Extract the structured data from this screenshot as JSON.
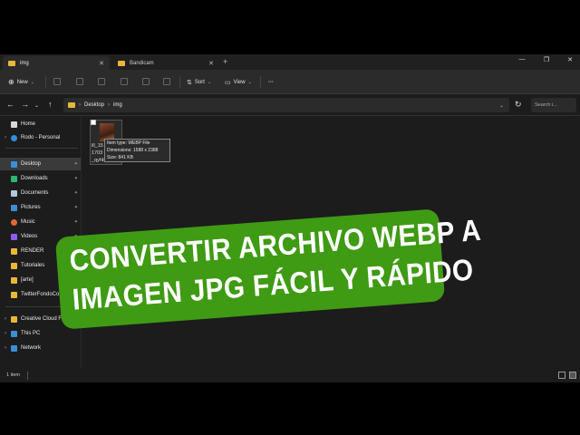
{
  "tabs": [
    {
      "label": "img",
      "active": true
    },
    {
      "label": "Bandicam",
      "active": false
    }
  ],
  "toolbar": {
    "new_label": "New",
    "sort_label": "Sort",
    "view_label": "View",
    "more_label": "···"
  },
  "address": {
    "path": [
      "Desktop",
      "img"
    ],
    "search_placeholder": "Search i..."
  },
  "sidebar": {
    "items": [
      {
        "label": "Home",
        "icon": "home-icon"
      },
      {
        "label": "Rodo - Personal",
        "icon": "onedrive-icon"
      },
      {
        "label": "Desktop",
        "icon": "desktop-icon",
        "pinned": true,
        "selected": true
      },
      {
        "label": "Downloads",
        "icon": "download-icon",
        "pinned": true
      },
      {
        "label": "Documents",
        "icon": "document-icon",
        "pinned": true
      },
      {
        "label": "Pictures",
        "icon": "pictures-icon",
        "pinned": true
      },
      {
        "label": "Music",
        "icon": "music-icon",
        "pinned": true
      },
      {
        "label": "Videos",
        "icon": "videos-icon",
        "pinned": true
      },
      {
        "label": "RENDER",
        "icon": "folder-icon"
      },
      {
        "label": "Tutoriales",
        "icon": "folder-icon"
      },
      {
        "label": "[arte]",
        "icon": "folder-icon"
      },
      {
        "label": "TwitterFondoCo",
        "icon": "folder-icon"
      },
      {
        "label": "Creative Cloud File",
        "icon": "creative-cloud-icon"
      },
      {
        "label": "This PC",
        "icon": "pc-icon"
      },
      {
        "label": "Network",
        "icon": "network-icon"
      }
    ]
  },
  "file": {
    "name_line1": "ill_15",
    "name_line2": "1703",
    "name_line3": "_qyhbbnaqp",
    "tooltip": {
      "type": "Item type: WEBP File",
      "dimensions": "Dimensions: 1588 x 2388",
      "size": "Size: 841 KB"
    }
  },
  "status": {
    "count": "1 item"
  },
  "banner": {
    "line1": "CONVERTIR ARCHIVO WEBP A",
    "line2": "IMAGEN JPG FÁCIL Y RÁPIDO",
    "color": "#3f9a14"
  }
}
